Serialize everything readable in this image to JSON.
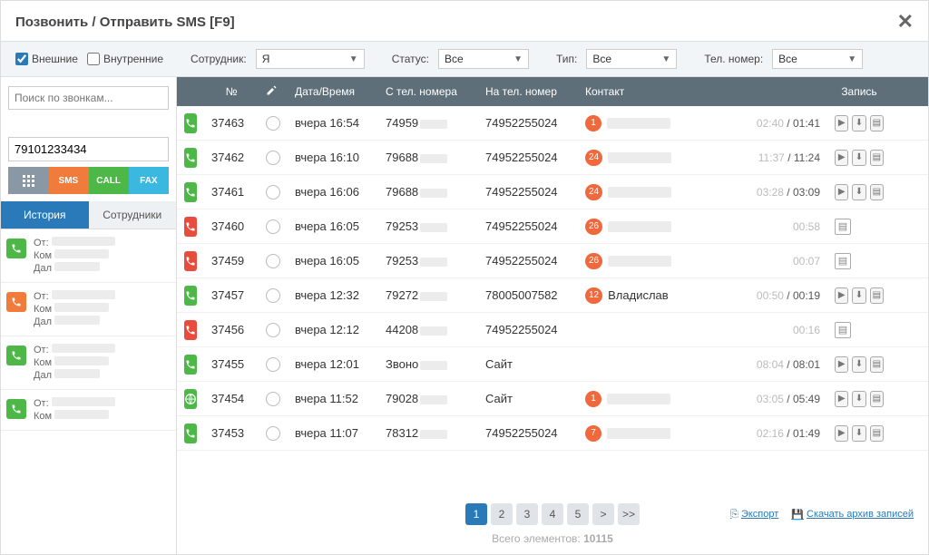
{
  "modal": {
    "title": "Позвонить / Отправить SMS [F9]"
  },
  "filters": {
    "external": "Внешние",
    "internal": "Внутренние",
    "employee_label": "Сотрудник:",
    "employee_value": "Я",
    "status_label": "Статус:",
    "status_value": "Все",
    "type_label": "Тип:",
    "type_value": "Все",
    "phone_label": "Тел. номер:",
    "phone_value": "Все"
  },
  "sidebar": {
    "search_placeholder": "Поиск по звонкам...",
    "phone_value": "79101233434",
    "btn_sms": "SMS",
    "btn_call": "CALL",
    "btn_fax": "FAX",
    "tab_history": "История",
    "tab_employees": "Сотрудники",
    "calls": [
      {
        "icon": "green",
        "l1": "От:",
        "l2": "Ком",
        "l3": "Дал"
      },
      {
        "icon": "orange",
        "l1": "От:",
        "l2": "Ком",
        "l3": "Дал"
      },
      {
        "icon": "green",
        "l1": "От:",
        "l2": "Ком",
        "l3": "Дал"
      },
      {
        "icon": "green",
        "l1": "От:",
        "l2": "Ком",
        "l3": ""
      }
    ]
  },
  "table": {
    "headers": {
      "num": "№",
      "date": "Дата/Время",
      "from": "С тел. номера",
      "to": "На тел. номер",
      "contact": "Контакт",
      "rec": "Запись"
    },
    "rows": [
      {
        "icon": "in",
        "num": "37463",
        "date": "вчера 16:54",
        "from": "74959",
        "to": "74952255024",
        "badge": "1",
        "contact": "",
        "dur_a": "02:40",
        "dur_b": "01:41",
        "rec": true
      },
      {
        "icon": "in",
        "num": "37462",
        "date": "вчера 16:10",
        "from": "79688",
        "to": "74952255024",
        "badge": "24",
        "contact": "",
        "dur_a": "11:37",
        "dur_b": "11:24",
        "rec": true
      },
      {
        "icon": "in",
        "num": "37461",
        "date": "вчера 16:06",
        "from": "79688",
        "to": "74952255024",
        "badge": "24",
        "contact": "",
        "dur_a": "03:28",
        "dur_b": "03:09",
        "rec": true
      },
      {
        "icon": "out",
        "num": "37460",
        "date": "вчера 16:05",
        "from": "79253",
        "to": "74952255024",
        "badge": "26",
        "contact": "",
        "dur_a": "",
        "dur_b": "00:58",
        "rec": false
      },
      {
        "icon": "out",
        "num": "37459",
        "date": "вчера 16:05",
        "from": "79253",
        "to": "74952255024",
        "badge": "26",
        "contact": "",
        "dur_a": "",
        "dur_b": "00:07",
        "rec": false
      },
      {
        "icon": "in",
        "num": "37457",
        "date": "вчера 12:32",
        "from": "79272",
        "to": "78005007582",
        "badge": "12",
        "contact": "Владислав",
        "dur_a": "00:50",
        "dur_b": "00:19",
        "rec": true
      },
      {
        "icon": "out",
        "num": "37456",
        "date": "вчера 12:12",
        "from": "44208",
        "to": "74952255024",
        "badge": "",
        "contact": "",
        "dur_a": "",
        "dur_b": "00:16",
        "rec": false
      },
      {
        "icon": "in",
        "num": "37455",
        "date": "вчера 12:01",
        "from": "Звоно",
        "to": "Сайт",
        "badge": "",
        "contact": "",
        "dur_a": "08:04",
        "dur_b": "08:01",
        "rec": true
      },
      {
        "icon": "web",
        "num": "37454",
        "date": "вчера 11:52",
        "from": "79028",
        "to": "Сайт",
        "badge": "1",
        "contact": "",
        "dur_a": "03:05",
        "dur_b": "05:49",
        "rec": true
      },
      {
        "icon": "in",
        "num": "37453",
        "date": "вчера 11:07",
        "from": "78312",
        "to": "74952255024",
        "badge": "7",
        "contact": "",
        "dur_a": "02:16",
        "dur_b": "01:49",
        "rec": true
      }
    ]
  },
  "pager": {
    "pages": [
      "1",
      "2",
      "3",
      "4",
      "5"
    ],
    "next": ">",
    "last": ">>",
    "export": "Экспорт",
    "archive": "Скачать архив записей"
  },
  "total": {
    "label": "Всего элементов:",
    "count": "10115"
  }
}
